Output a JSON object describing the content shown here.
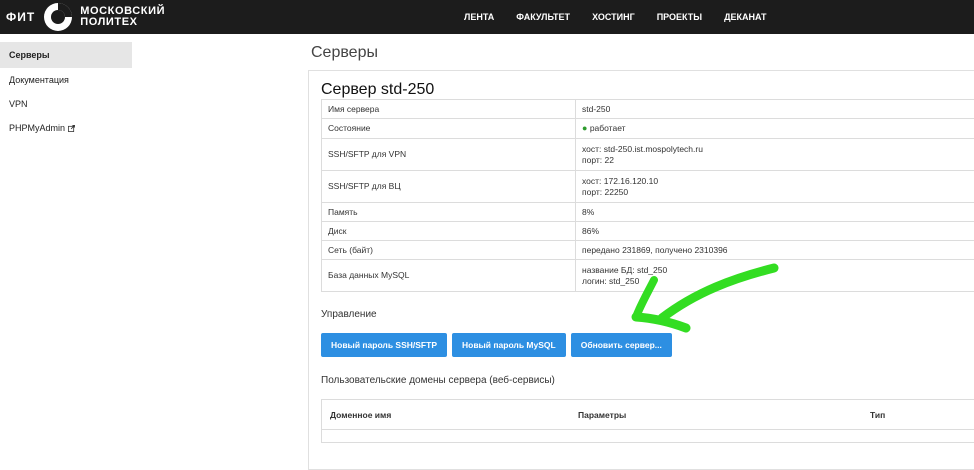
{
  "brand": {
    "fit": "ФИТ",
    "name_line1": "МОСКОВСКИЙ",
    "name_line2": "ПОЛИТЕХ"
  },
  "nav": [
    "ЛЕНТА",
    "ФАКУЛЬТЕТ",
    "ХОСТИНГ",
    "ПРОЕКТЫ",
    "ДЕКАНАТ"
  ],
  "sidebar": {
    "items": [
      {
        "label": "Серверы",
        "active": true
      },
      {
        "label": "Документация"
      },
      {
        "label": "VPN"
      },
      {
        "label": "PHPMyAdmin",
        "icon": "external-link-icon"
      }
    ]
  },
  "main": {
    "page_title": "Серверы",
    "server_title": "Сервер std-250",
    "info": [
      {
        "key": "Имя сервера",
        "value": [
          "std-250"
        ]
      },
      {
        "key": "Состояние",
        "value": [
          "работает"
        ],
        "status_color": "#2e9b2e"
      },
      {
        "key": "SSH/SFTP для VPN",
        "value": [
          "хост: std-250.ist.mospolytech.ru",
          "порт: 22"
        ]
      },
      {
        "key": "SSH/SFTP для ВЦ",
        "value": [
          "хост: 172.16.120.10",
          "порт: 22250"
        ]
      },
      {
        "key": "Память",
        "value": [
          "8%"
        ]
      },
      {
        "key": "Диск",
        "value": [
          "86%"
        ]
      },
      {
        "key": "Сеть (байт)",
        "value": [
          "передано 231869, получено 2310396"
        ]
      },
      {
        "key": "База данных MySQL",
        "value": [
          "название БД: std_250",
          "логин: std_250"
        ]
      }
    ],
    "management_label": "Управление",
    "buttons": [
      "Новый пароль SSH/SFTP",
      "Новый пароль MySQL",
      "Обновить сервер..."
    ],
    "domains_label": "Пользовательские домены сервера (веб-сервисы)",
    "domains_table": {
      "headers": [
        "Доменное имя",
        "Параметры",
        "Тип"
      ]
    }
  },
  "colors": {
    "navbar": "#1c1c1c",
    "button": "#2d8fe2",
    "annotation_arrow": "#33dd22"
  }
}
